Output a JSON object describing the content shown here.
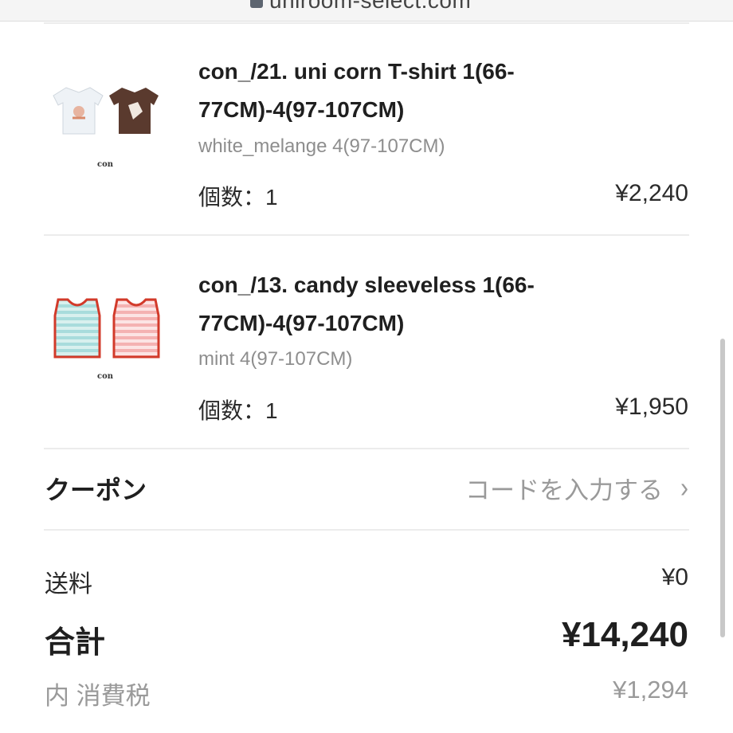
{
  "browser": {
    "url": "uniroom-select.com"
  },
  "cart": {
    "items": [
      {
        "name": "con_/21. uni corn T-shirt 1(66-77CM)-4(97-107CM)",
        "variant": "white_melange 4(97-107CM)",
        "quantity_label": "個数：1",
        "price": "¥2,240",
        "thumb_brand": "con"
      },
      {
        "name": "con_/13. candy sleeveless 1(66-77CM)-4(97-107CM)",
        "variant": "mint 4(97-107CM)",
        "quantity_label": "個数：1",
        "price": "¥1,950",
        "thumb_brand": "con"
      }
    ]
  },
  "coupon": {
    "label": "クーポン",
    "action": "コードを入力する",
    "chevron_icon": "chevron-right-icon"
  },
  "summary": {
    "shipping_label": "送料",
    "shipping_value": "¥0",
    "total_label": "合計",
    "total_value": "¥14,240",
    "tax_label": "内 消費税",
    "tax_value": "¥1,294"
  },
  "colors": {
    "text": "#222222",
    "muted": "#9a9a9a",
    "divider": "#ececec",
    "accent_red": "#d23a2a"
  }
}
